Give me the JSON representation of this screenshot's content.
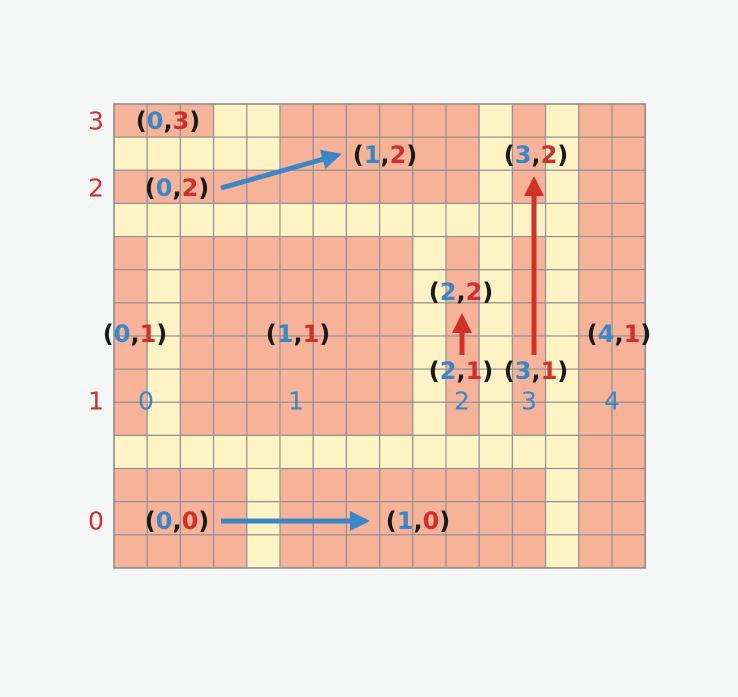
{
  "colors": {
    "background": "#f5f6f6",
    "room_fill": "#f7b39a",
    "corridor_fill": "#fdf3c4",
    "grid_line": "#8f8f8f",
    "blue": "#3a86c6",
    "red": "#d0312d",
    "paren": "#1a1a1a"
  },
  "grid": {
    "columns": 16,
    "rows": 14
  },
  "corridor_cells": [
    [
      3,
      0
    ],
    [
      4,
      0
    ],
    [
      11,
      0
    ],
    [
      13,
      0
    ],
    [
      0,
      1
    ],
    [
      1,
      1
    ],
    [
      2,
      1
    ],
    [
      3,
      1
    ],
    [
      4,
      1
    ],
    [
      11,
      1
    ],
    [
      13,
      1
    ],
    [
      11,
      2
    ],
    [
      13,
      2
    ],
    [
      0,
      3
    ],
    [
      1,
      3
    ],
    [
      2,
      3
    ],
    [
      3,
      3
    ],
    [
      4,
      3
    ],
    [
      5,
      3
    ],
    [
      6,
      3
    ],
    [
      7,
      3
    ],
    [
      8,
      3
    ],
    [
      9,
      3
    ],
    [
      10,
      3
    ],
    [
      11,
      3
    ],
    [
      12,
      3
    ],
    [
      13,
      3
    ],
    [
      1,
      4
    ],
    [
      9,
      4
    ],
    [
      11,
      4
    ],
    [
      13,
      4
    ],
    [
      1,
      5
    ],
    [
      9,
      5
    ],
    [
      11,
      5
    ],
    [
      13,
      5
    ],
    [
      1,
      6
    ],
    [
      9,
      6
    ],
    [
      11,
      6
    ],
    [
      13,
      6
    ],
    [
      1,
      7
    ],
    [
      9,
      7
    ],
    [
      11,
      7
    ],
    [
      13,
      7
    ],
    [
      1,
      8
    ],
    [
      9,
      8
    ],
    [
      11,
      8
    ],
    [
      13,
      8
    ],
    [
      1,
      9
    ],
    [
      9,
      9
    ],
    [
      11,
      9
    ],
    [
      13,
      9
    ],
    [
      0,
      10
    ],
    [
      1,
      10
    ],
    [
      2,
      10
    ],
    [
      3,
      10
    ],
    [
      4,
      10
    ],
    [
      5,
      10
    ],
    [
      6,
      10
    ],
    [
      7,
      10
    ],
    [
      8,
      10
    ],
    [
      9,
      10
    ],
    [
      10,
      10
    ],
    [
      11,
      10
    ],
    [
      12,
      10
    ],
    [
      13,
      10
    ],
    [
      4,
      11
    ],
    [
      13,
      11
    ],
    [
      4,
      12
    ],
    [
      13,
      12
    ],
    [
      4,
      13
    ],
    [
      13,
      13
    ]
  ],
  "row_labels": [
    {
      "id": "3",
      "text": "3"
    },
    {
      "id": "2",
      "text": "2"
    },
    {
      "id": "1",
      "text": "1"
    },
    {
      "id": "0",
      "text": "0"
    }
  ],
  "column_labels": [
    {
      "id": "0",
      "text": "0"
    },
    {
      "id": "1",
      "text": "1"
    },
    {
      "id": "2",
      "text": "2"
    },
    {
      "id": "3",
      "text": "3"
    },
    {
      "id": "4",
      "text": "4"
    }
  ],
  "room_labels": [
    {
      "id": "0-3",
      "x": "0",
      "y": "3"
    },
    {
      "id": "0-2",
      "x": "0",
      "y": "2"
    },
    {
      "id": "1-2",
      "x": "1",
      "y": "2"
    },
    {
      "id": "3-2",
      "x": "3",
      "y": "2"
    },
    {
      "id": "2-2",
      "x": "2",
      "y": "2"
    },
    {
      "id": "0-1",
      "x": "0",
      "y": "1"
    },
    {
      "id": "1-1",
      "x": "1",
      "y": "1"
    },
    {
      "id": "4-1",
      "x": "4",
      "y": "1"
    },
    {
      "id": "2-1",
      "x": "2",
      "y": "1"
    },
    {
      "id": "3-1",
      "x": "3",
      "y": "1"
    },
    {
      "id": "0-0",
      "x": "0",
      "y": "0"
    },
    {
      "id": "1-0",
      "x": "1",
      "y": "0"
    }
  ],
  "arrows": [
    {
      "id": "0-2-to-1-2",
      "color": "blue"
    },
    {
      "id": "0-0-to-1-0",
      "color": "blue"
    },
    {
      "id": "2-1-to-2-2",
      "color": "red"
    },
    {
      "id": "3-1-to-3-2",
      "color": "red"
    }
  ]
}
